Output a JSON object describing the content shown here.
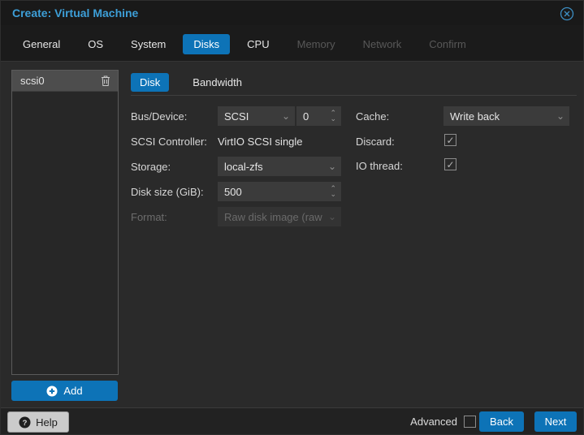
{
  "colors": {
    "accent_blue": "#0d73b7",
    "title_blue": "#3d9fd8",
    "body_background": "#2a2a2a",
    "header_background": "#191919"
  },
  "window": {
    "title": "Create: Virtual Machine"
  },
  "wizard_tabs": [
    {
      "label": "General",
      "state": "enabled"
    },
    {
      "label": "OS",
      "state": "enabled"
    },
    {
      "label": "System",
      "state": "enabled"
    },
    {
      "label": "Disks",
      "state": "active"
    },
    {
      "label": "CPU",
      "state": "enabled"
    },
    {
      "label": "Memory",
      "state": "disabled"
    },
    {
      "label": "Network",
      "state": "disabled"
    },
    {
      "label": "Confirm",
      "state": "disabled"
    }
  ],
  "disk_list": {
    "items": [
      {
        "name": "scsi0"
      }
    ],
    "add_button": "Add"
  },
  "inner_tabs": [
    {
      "label": "Disk",
      "state": "active"
    },
    {
      "label": "Bandwidth",
      "state": "enabled"
    }
  ],
  "form": {
    "bus_device": {
      "label": "Bus/Device:",
      "value": "SCSI",
      "number": "0"
    },
    "scsi_controller": {
      "label": "SCSI Controller:",
      "value": "VirtIO SCSI single"
    },
    "storage": {
      "label": "Storage:",
      "value": "local-zfs"
    },
    "disk_size": {
      "label": "Disk size (GiB):",
      "value": "500"
    },
    "format": {
      "label": "Format:",
      "value": "Raw disk image (raw",
      "disabled": true
    },
    "cache": {
      "label": "Cache:",
      "value": "Write back"
    },
    "discard": {
      "label": "Discard:",
      "checked": true
    },
    "io_thread": {
      "label": "IO thread:",
      "checked": true
    }
  },
  "footer": {
    "help_button": "Help",
    "advanced_label": "Advanced",
    "advanced_checked": false,
    "back_button": "Back",
    "next_button": "Next"
  },
  "icons": {
    "close": "close-circle-icon",
    "trash": "trash-icon",
    "add": "plus-circle-icon",
    "help": "question-circle-icon",
    "dropdown": "chevron-down-icon",
    "spinner": "up-down-arrows-icon"
  }
}
